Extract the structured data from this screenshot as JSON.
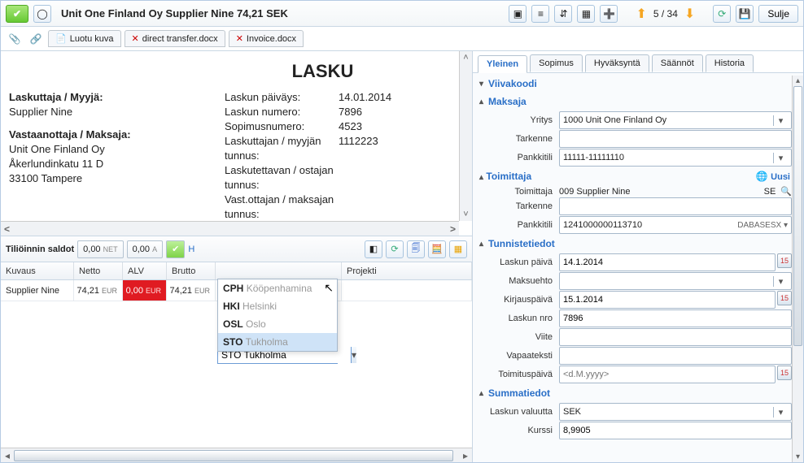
{
  "title_bar": {
    "text": "Unit One Finland Oy   Supplier Nine   74,21   SEK",
    "close_label": "Sulje",
    "page_indicator": "5 / 34"
  },
  "sub_tabs": [
    {
      "label": "Luotu kuva"
    },
    {
      "label": "direct transfer.docx"
    },
    {
      "label": "Invoice.docx"
    }
  ],
  "document": {
    "heading": "LASKU",
    "seller_label": "Laskuttaja / Myyjä:",
    "seller_name": "Supplier Nine",
    "recipient_label": "Vastaanottaja / Maksaja:",
    "recipient_lines": [
      "Unit One Finland Oy",
      "Åkerlundinkatu 11 D",
      "33100 Tampere"
    ],
    "right_labels": {
      "date": "Laskun päiväys:",
      "number": "Laskun numero:",
      "contract": "Sopimusnumero:",
      "seller_id": "Laskuttajan / myyjän tunnus:",
      "buyer_id": "Laskutettavan / ostajan tunnus:",
      "payer_id": "Vast.ottajan / maksajan tunnus:"
    },
    "right_values": {
      "date": "14.01.2014",
      "number": "7896",
      "contract": "4523",
      "payer_id": "1112223"
    }
  },
  "mid_toolbar": {
    "balances": "Tiliöinnin saldot",
    "net": "0,00",
    "net_suffix": "NET",
    "a": "0,00",
    "a_suffix": "A"
  },
  "grid": {
    "headers": [
      "Kuvaus",
      "Netto",
      "ALV",
      "Brutto",
      "",
      "Projekti"
    ],
    "row": {
      "kuvaus": "Supplier Nine",
      "netto": "74,21",
      "alv": "0,00",
      "brutto": "74,21",
      "input_value": "STO Tukholma"
    }
  },
  "autocomplete": [
    {
      "code": "CPH",
      "name": "Kööpenhamina"
    },
    {
      "code": "HKI",
      "name": "Helsinki"
    },
    {
      "code": "OSL",
      "name": "Oslo"
    },
    {
      "code": "STO",
      "name": "Tukholma"
    }
  ],
  "tabs": [
    "Yleinen",
    "Sopimus",
    "Hyväksyntä",
    "Säännöt",
    "Historia"
  ],
  "sections": {
    "viivakoodi": "Viivakoodi",
    "maksaja": {
      "title": "Maksaja",
      "yritys_lbl": "Yritys",
      "yritys_val": "1000 Unit One Finland Oy",
      "tarkenne_lbl": "Tarkenne",
      "pankkitili_lbl": "Pankkitili",
      "pankkitili_val": "11111-11111110"
    },
    "toimittaja": {
      "title": "Toimittaja",
      "uusi": "Uusi",
      "toimittaja_lbl": "Toimittaja",
      "toimittaja_val": "009 Supplier Nine",
      "toimittaja_country": "SE",
      "tarkenne_lbl": "Tarkenne",
      "pankkitili_lbl": "Pankkitili",
      "pankkitili_val": "1241000000113710",
      "pankkitili_right": "DABASESX"
    },
    "tunniste": {
      "title": "Tunnistetiedot",
      "laskun_paiva_lbl": "Laskun päivä",
      "laskun_paiva_val": "14.1.2014",
      "maksuehto_lbl": "Maksuehto",
      "kirjauspaiva_lbl": "Kirjauspäivä",
      "kirjauspaiva_val": "15.1.2014",
      "laskun_nro_lbl": "Laskun nro",
      "laskun_nro_val": "7896",
      "viite_lbl": "Viite",
      "vapaateksti_lbl": "Vapaateksti",
      "toimituspaiva_lbl": "Toimituspäivä",
      "toimituspaiva_ph": "<d.M.yyyy>"
    },
    "summa": {
      "title": "Summatiedot",
      "valuutta_lbl": "Laskun valuutta",
      "valuutta_val": "SEK",
      "kurssi_lbl": "Kurssi",
      "kurssi_val": "8,9905"
    }
  }
}
